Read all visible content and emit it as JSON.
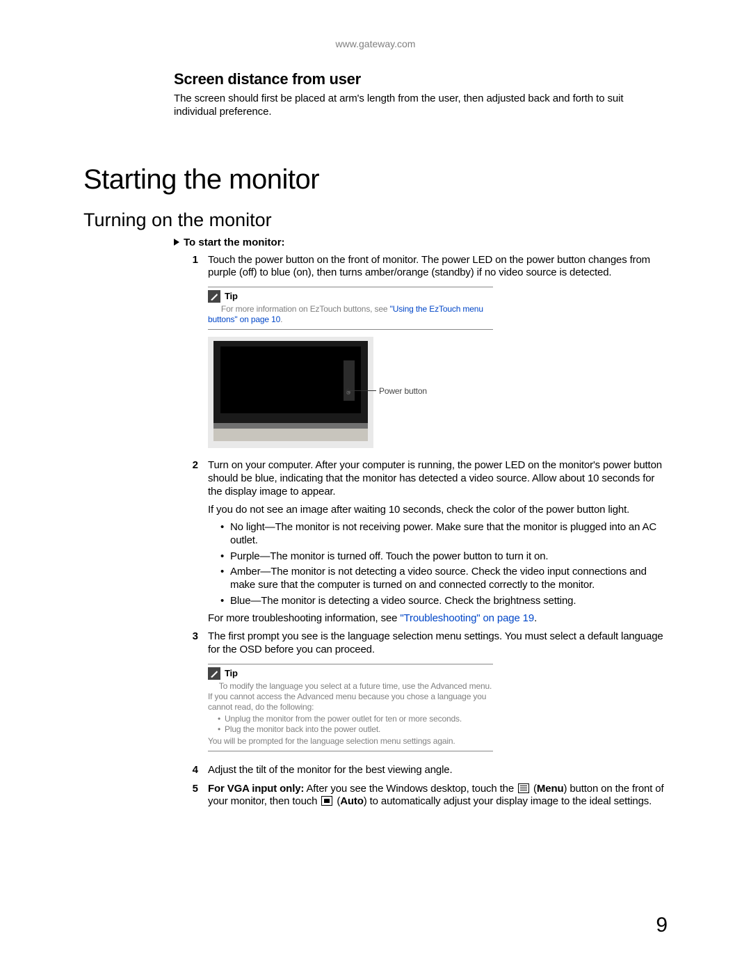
{
  "header_url": "www.gateway.com",
  "section1": {
    "title": "Screen distance from user",
    "body": "The screen should first be placed at arm's length from the user, then adjusted back and forth to suit individual preference."
  },
  "h1": "Starting the monitor",
  "h2": "Turning on the monitor",
  "proc_head": "To start the monitor:",
  "steps": {
    "s1": {
      "num": "1",
      "text": "Touch the power button on the front of monitor. The power LED on the power button changes from purple (off) to blue (on), then turns amber/orange (standby) if no video source is detected."
    },
    "tip1": {
      "label": "Tip",
      "lead": "For more information on EzTouch buttons, see ",
      "link": "\"Using the EzTouch menu buttons\" on page 10",
      "tail": "."
    },
    "callout": "Power button",
    "s2": {
      "num": "2",
      "p1": "Turn on your computer. After your computer is running, the power LED on the monitor's power button should be blue, indicating that the monitor has detected a video source. Allow about 10 seconds for the display image to appear.",
      "p2": "If you do not see an image after waiting 10 seconds, check the color of the power button light.",
      "b1": "No light—The monitor is not receiving power. Make sure that the monitor is plugged into an AC outlet.",
      "b2": "Purple—The monitor is turned off. Touch the power button to turn it on.",
      "b3": "Amber—The monitor is not detecting a video source. Check the video input connections and make sure that the computer is turned on and connected correctly to the monitor.",
      "b4": "Blue—The monitor is detecting a video source. Check the brightness setting.",
      "trail_lead": "For more troubleshooting information, see ",
      "trail_link": "\"Troubleshooting\" on page 19",
      "trail_tail": "."
    },
    "s3": {
      "num": "3",
      "text": "The first prompt you see is the language selection menu settings. You must select a default language for the OSD before you can proceed."
    },
    "tip2": {
      "label": "Tip",
      "l1": "To modify the language you select at a future time, use the Advanced menu.",
      "l2": "If you cannot access the Advanced menu because you chose a language you cannot read, do the following:",
      "b1": "Unplug the monitor from the power outlet for ten or more seconds.",
      "b2": "Plug the monitor back into the power outlet.",
      "l3": "You will be prompted for the language selection menu settings again."
    },
    "s4": {
      "num": "4",
      "text": "Adjust the tilt of the monitor for the best viewing angle."
    },
    "s5": {
      "num": "5",
      "lead": "For VGA input only:",
      "t1": " After you see the Windows desktop, touch the ",
      "menu_label": "Menu",
      "t2": ") button on the front of your monitor, then touch ",
      "auto_label": "Auto",
      "t3": ") to automatically adjust your display image to the ideal settings."
    }
  },
  "page_number": "9"
}
